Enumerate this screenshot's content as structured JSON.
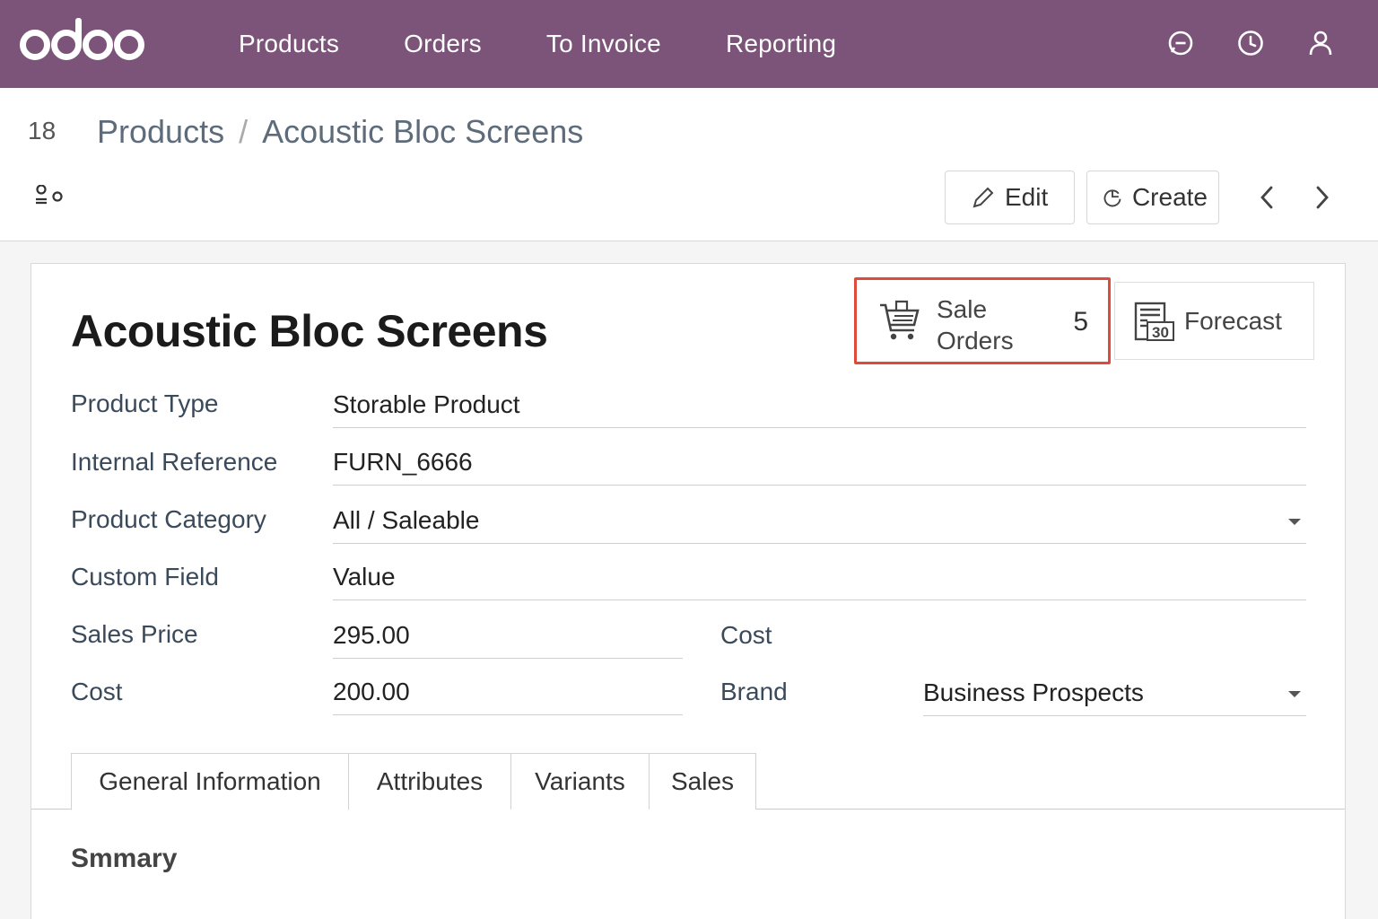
{
  "app": {
    "brand": "odoo",
    "colors": {
      "navbar": "#7c5479",
      "highlight": "#e04a3b"
    }
  },
  "navbar": {
    "menu": [
      "Products",
      "Orders",
      "To Invoice",
      "Reporting"
    ],
    "icons": [
      "chat-icon",
      "clock-icon",
      "user-icon"
    ]
  },
  "control_panel": {
    "record_count": "18",
    "breadcrumb": {
      "parent": "Products",
      "separator": "/",
      "current": "Acoustic Bloc Screens"
    },
    "edit_label": "Edit",
    "create_label": "Create"
  },
  "form": {
    "title": "Acoustic Bloc Screens",
    "smart_buttons": {
      "sale_orders": {
        "label": "Sale Orders",
        "count": "5"
      },
      "forecast": {
        "label": "Forecast",
        "icon_day": "30"
      }
    },
    "fields": {
      "product_type": {
        "label": "Product Type",
        "value": "Storable Product"
      },
      "internal_reference": {
        "label": "Internal Reference",
        "value": "FURN_6666"
      },
      "product_category": {
        "label": "Product Category",
        "value": "All / Saleable"
      },
      "custom_field": {
        "label": "Custom Field",
        "value": "Value"
      },
      "sales_price": {
        "label": "Sales Price",
        "value": "295.00"
      },
      "cost": {
        "label": "Cost",
        "value": "200.00"
      },
      "cost_right": {
        "label": "Cost"
      },
      "brand": {
        "label": "Brand",
        "value": "Business Prospects"
      }
    },
    "tabs": [
      "General Information",
      "Attributes",
      "Variants",
      "Sales"
    ],
    "active_tab": "General Information",
    "section_heading": "Smmary"
  }
}
